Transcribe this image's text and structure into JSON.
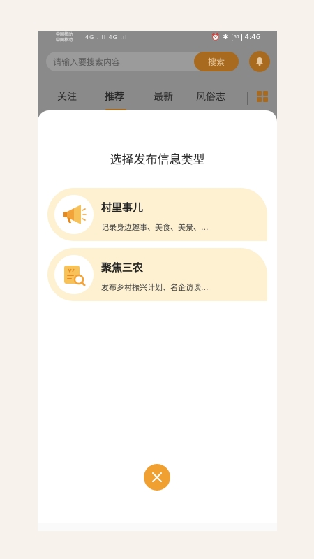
{
  "status_bar": {
    "carrier_1": "中国移动",
    "carrier_2": "中国移动",
    "signal": "4G .ıll 4G .ıll",
    "battery": "57",
    "time": "4:46"
  },
  "header": {
    "search_placeholder": "请输入要搜索内容",
    "search_button": "搜索",
    "icons": {
      "bell": "bell-icon",
      "grid": "grid-icon"
    }
  },
  "tabs": [
    {
      "label": "关注",
      "active": false
    },
    {
      "label": "推荐",
      "active": true
    },
    {
      "label": "最新",
      "active": false
    },
    {
      "label": "风俗志",
      "active": false
    }
  ],
  "sheet": {
    "title": "选择发布信息类型",
    "options": [
      {
        "title": "村里事儿",
        "desc": "记录身边趣事、美食、美景、...",
        "icon": "megaphone-icon"
      },
      {
        "title": "聚焦三农",
        "desc": "发布乡村振兴计划、名企访谈...",
        "icon": "document-search-icon"
      }
    ],
    "close_icon": "close-icon"
  },
  "colors": {
    "accent": "#f0a030",
    "accent_dim": "#a86a1e",
    "option_bg": "#fdf1d2",
    "overlay": "#8a8a8a"
  }
}
